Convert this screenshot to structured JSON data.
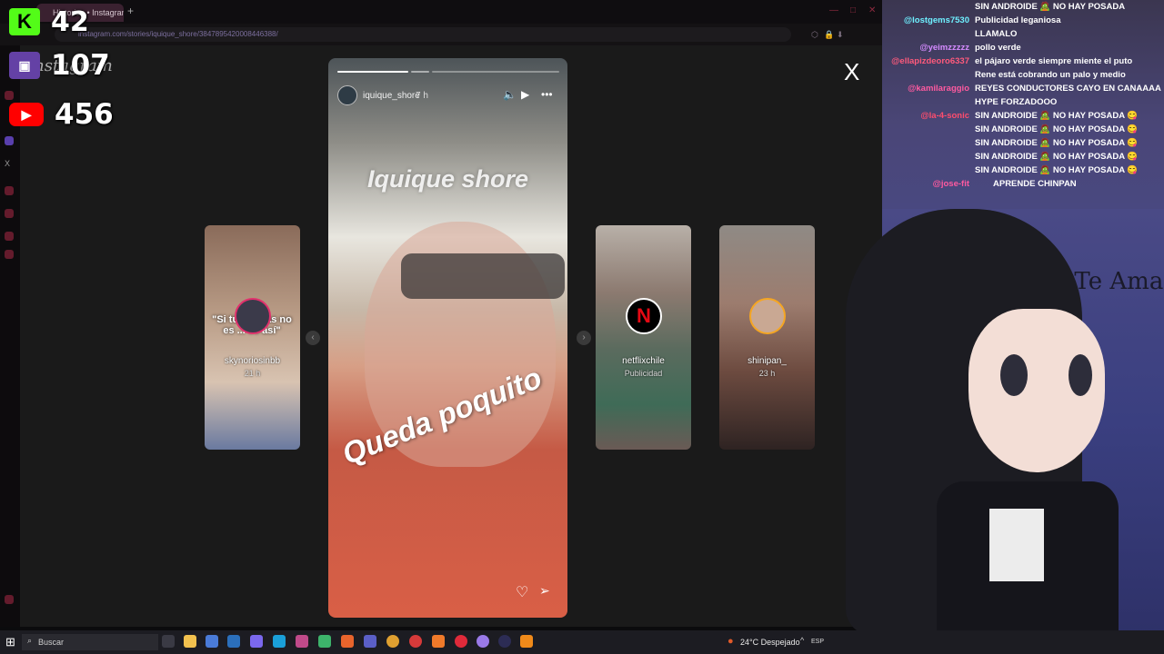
{
  "browser": {
    "tab_title": "Historias • Instagram",
    "url": "instagram.com/stories/iquique_shore/3847895420008446388/",
    "new_tab_symbol": "+"
  },
  "counters": {
    "kick": {
      "letter": "K",
      "count": "42",
      "color": "#53fc18"
    },
    "twitch": {
      "count": "107",
      "color": "#9146ff"
    },
    "youtube": {
      "count": "456",
      "color": "#ff0000"
    }
  },
  "instagram_logo": "Instagram",
  "story_viewer": {
    "close_symbol": "X",
    "main": {
      "username": "iquique_shore",
      "time": "7 h",
      "caption_top": "Iquique shore",
      "caption_bottom": "Queda poquito"
    },
    "side_stories": [
      {
        "username": "skynoriosinbb",
        "time": "21 h",
        "overlay_text": "\"Si tú quieras no es ... es así\""
      },
      {
        "username": "netflixchile",
        "time": "Publicidad",
        "badge": "N"
      },
      {
        "username": "shinipan_",
        "time": "23 h"
      }
    ]
  },
  "chat": {
    "messages": [
      {
        "user": "",
        "text": "SIN ANDROIDE 🧟 NO HAY POSADA"
      },
      {
        "user": "@lostgems7530",
        "text": "Publicidad leganiosa"
      },
      {
        "user": "",
        "text": "LLAMALO"
      },
      {
        "user": "@yeimzzzzz",
        "text": "pollo verde"
      },
      {
        "user": "@ellapizdeoro6337",
        "text": "el pájaro verde siempre miente el puto"
      },
      {
        "user": "",
        "text": "Rene está cobrando un palo y medio"
      },
      {
        "user": "@kamilaraggio",
        "text": "REYES CONDUCTORES CAYO EN CANAAAA"
      },
      {
        "user": "",
        "text": "HYPE FORZADOOO"
      },
      {
        "user": "@la-4-sonic",
        "text": "SIN ANDROIDE 🧟 NO HAY POSADA 😋"
      },
      {
        "user": "",
        "text": "SIN ANDROIDE 🧟 NO HAY POSADA 😋"
      },
      {
        "user": "",
        "text": "SIN ANDROIDE 🧟 NO HAY POSADA 😋"
      },
      {
        "user": "",
        "text": "SIN ANDROIDE 🧟 NO HAY POSADA 😋"
      },
      {
        "user": "",
        "text": "SIN ANDROIDE 🧟 NO HAY POSADA 😋"
      },
      {
        "user": "@jose-fit",
        "text": "APRENDE CHINPAN"
      }
    ]
  },
  "overlay_watermark": "Dios Te Ama",
  "taskbar": {
    "search_label": "Buscar",
    "weather": "24°C Despejado",
    "lang": "ESP"
  }
}
